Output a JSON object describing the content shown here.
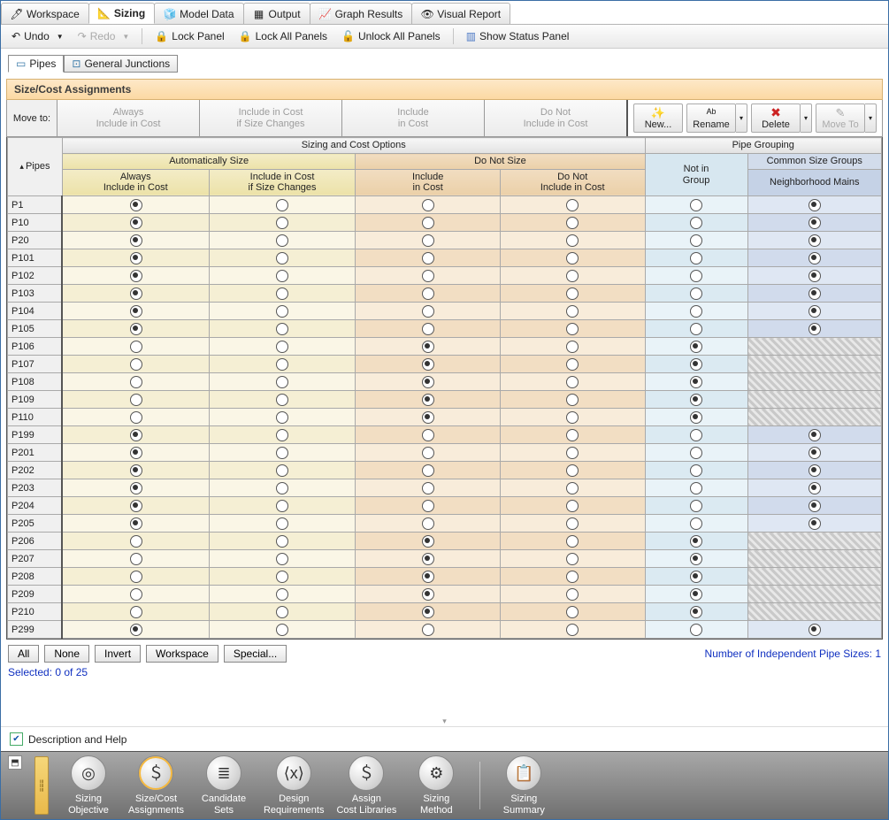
{
  "tabs": [
    "Workspace",
    "Sizing",
    "Model Data",
    "Output",
    "Graph Results",
    "Visual Report"
  ],
  "active_tab": 1,
  "toolbar": {
    "undo": "Undo",
    "redo": "Redo",
    "lock": "Lock Panel",
    "lock_all": "Lock All Panels",
    "unlock_all": "Unlock All Panels",
    "status": "Show Status Panel"
  },
  "subtabs": [
    "Pipes",
    "General Junctions"
  ],
  "active_subtab": 0,
  "panel_title": "Size/Cost Assignments",
  "move_to_label": "Move to:",
  "move_buttons": [
    [
      "Always",
      "Include in Cost"
    ],
    [
      "Include in Cost",
      "if Size Changes"
    ],
    [
      "Include",
      "in Cost"
    ],
    [
      "Do Not",
      "Include in Cost"
    ]
  ],
  "grp_tools": {
    "new": "New...",
    "rename": "Rename",
    "delete": "Delete",
    "move": "Move To"
  },
  "headers": {
    "sizing_cost": "Sizing and Cost Options",
    "pipe_grouping": "Pipe Grouping",
    "auto": "Automatically Size",
    "nosize": "Do Not Size",
    "notgrp": "Not in\nGroup",
    "csg": "Common Size Groups",
    "csg_sub": "Neighborhood Mains",
    "cols": [
      [
        "Always",
        "Include in Cost"
      ],
      [
        "Include in Cost",
        "if Size Changes"
      ],
      [
        "Include",
        "in Cost"
      ],
      [
        "Do Not",
        "Include in Cost"
      ]
    ],
    "corner": "Pipes"
  },
  "rows": [
    {
      "id": "P1",
      "sizing": 0,
      "group": 1
    },
    {
      "id": "P10",
      "sizing": 0,
      "group": 1
    },
    {
      "id": "P20",
      "sizing": 0,
      "group": 1
    },
    {
      "id": "P101",
      "sizing": 0,
      "group": 1
    },
    {
      "id": "P102",
      "sizing": 0,
      "group": 1
    },
    {
      "id": "P103",
      "sizing": 0,
      "group": 1
    },
    {
      "id": "P104",
      "sizing": 0,
      "group": 1
    },
    {
      "id": "P105",
      "sizing": 0,
      "group": 1
    },
    {
      "id": "P106",
      "sizing": 2,
      "group": 0,
      "hatch": true
    },
    {
      "id": "P107",
      "sizing": 2,
      "group": 0,
      "hatch": true
    },
    {
      "id": "P108",
      "sizing": 2,
      "group": 0,
      "hatch": true
    },
    {
      "id": "P109",
      "sizing": 2,
      "group": 0,
      "hatch": true
    },
    {
      "id": "P110",
      "sizing": 2,
      "group": 0,
      "hatch": true
    },
    {
      "id": "P199",
      "sizing": 0,
      "group": 1
    },
    {
      "id": "P201",
      "sizing": 0,
      "group": 1
    },
    {
      "id": "P202",
      "sizing": 0,
      "group": 1
    },
    {
      "id": "P203",
      "sizing": 0,
      "group": 1
    },
    {
      "id": "P204",
      "sizing": 0,
      "group": 1
    },
    {
      "id": "P205",
      "sizing": 0,
      "group": 1
    },
    {
      "id": "P206",
      "sizing": 2,
      "group": 0,
      "hatch": true
    },
    {
      "id": "P207",
      "sizing": 2,
      "group": 0,
      "hatch": true
    },
    {
      "id": "P208",
      "sizing": 2,
      "group": 0,
      "hatch": true
    },
    {
      "id": "P209",
      "sizing": 2,
      "group": 0,
      "hatch": true
    },
    {
      "id": "P210",
      "sizing": 2,
      "group": 0,
      "hatch": true
    },
    {
      "id": "P299",
      "sizing": 0,
      "group": 1
    }
  ],
  "sel_buttons": [
    "All",
    "None",
    "Invert",
    "Workspace",
    "Special..."
  ],
  "indep_label": "Number of Independent Pipe Sizes: 1",
  "selected_label": "Selected: 0 of 25",
  "desc_label": "Description and Help",
  "bottom": [
    {
      "label": "Sizing\nObjective",
      "glyph": "◎"
    },
    {
      "label": "Size/Cost\nAssignments",
      "glyph": "＄",
      "active": true
    },
    {
      "label": "Candidate\nSets",
      "glyph": "≣"
    },
    {
      "label": "Design\nRequirements",
      "glyph": "⟨x⟩"
    },
    {
      "label": "Assign\nCost Libraries",
      "glyph": "＄"
    },
    {
      "label": "Sizing\nMethod",
      "glyph": "⚙"
    },
    {
      "label": "Sizing\nSummary",
      "glyph": "📋"
    }
  ]
}
